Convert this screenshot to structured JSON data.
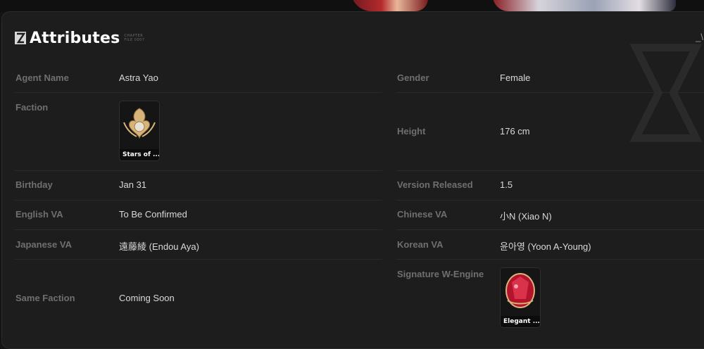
{
  "section": {
    "title": "Attributes",
    "mini_caption": [
      "CHAPTER",
      "FILE 0007"
    ],
    "corner_mark": "_\\"
  },
  "colors": {
    "panel_bg": "#1d1d1d",
    "label": "#6f6f6f",
    "value": "#d9d9d9",
    "divider": "#2a2a2a"
  },
  "left": {
    "agent_name": {
      "label": "Agent Name",
      "value": "Astra Yao"
    },
    "faction": {
      "label": "Faction",
      "card_caption": "Stars of ...",
      "icon": "faction-emblem-icon"
    },
    "birthday": {
      "label": "Birthday",
      "value": "Jan 31"
    },
    "english_va": {
      "label": "English VA",
      "value": "To Be Confirmed"
    },
    "japanese_va": {
      "label": "Japanese VA",
      "value": "遠藤綾 (Endou Aya)"
    },
    "same_faction": {
      "label": "Same Faction",
      "value": "Coming Soon"
    }
  },
  "right": {
    "gender": {
      "label": "Gender",
      "value": "Female"
    },
    "height": {
      "label": "Height",
      "value": "176 cm"
    },
    "version_released": {
      "label": "Version Released",
      "value": "1.5"
    },
    "chinese_va": {
      "label": "Chinese VA",
      "value": "小N (Xiao N)"
    },
    "korean_va": {
      "label": "Korean VA",
      "value": "윤아영 (Yoon A-Young)"
    },
    "signature_w_engine": {
      "label": "Signature W-Engine",
      "card_caption": "Elegant ...",
      "icon": "w-engine-icon"
    }
  }
}
